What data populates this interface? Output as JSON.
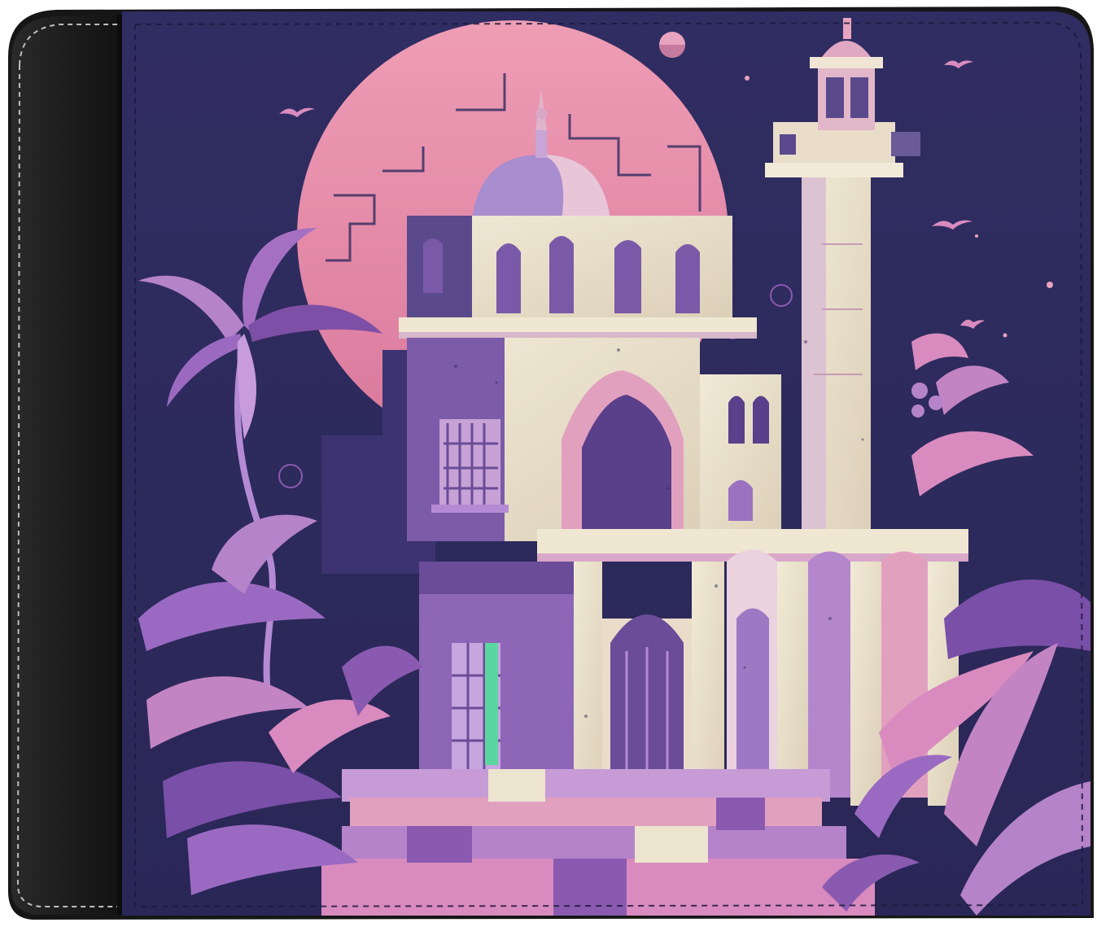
{
  "product": {
    "kind": "bifold wallet",
    "colors": {
      "background": "#ffffff",
      "leather_black": "#1e1e1e",
      "leather_highlight": "#3a3a3a",
      "stitch": "#bdbdbd",
      "panel_navy": "#2f2c5e",
      "panel_navy_dark": "#23204b",
      "moon_pink": "#e58aa8",
      "stone_cream": "#ece4cf",
      "violet": "#8a5ab0",
      "violet_dark": "#4a3878",
      "lilac": "#b58ad4",
      "pink_leaf": "#d98bbf",
      "green_glow": "#5cd6a0"
    }
  },
  "artwork": {
    "scene": "mosque-with-minaret-at-night",
    "elements": [
      "moon-disc",
      "small-moon",
      "dome",
      "minaret",
      "arched-gateway",
      "colonnade",
      "palm-tree",
      "tropical-leaves",
      "birds",
      "steps"
    ]
  }
}
